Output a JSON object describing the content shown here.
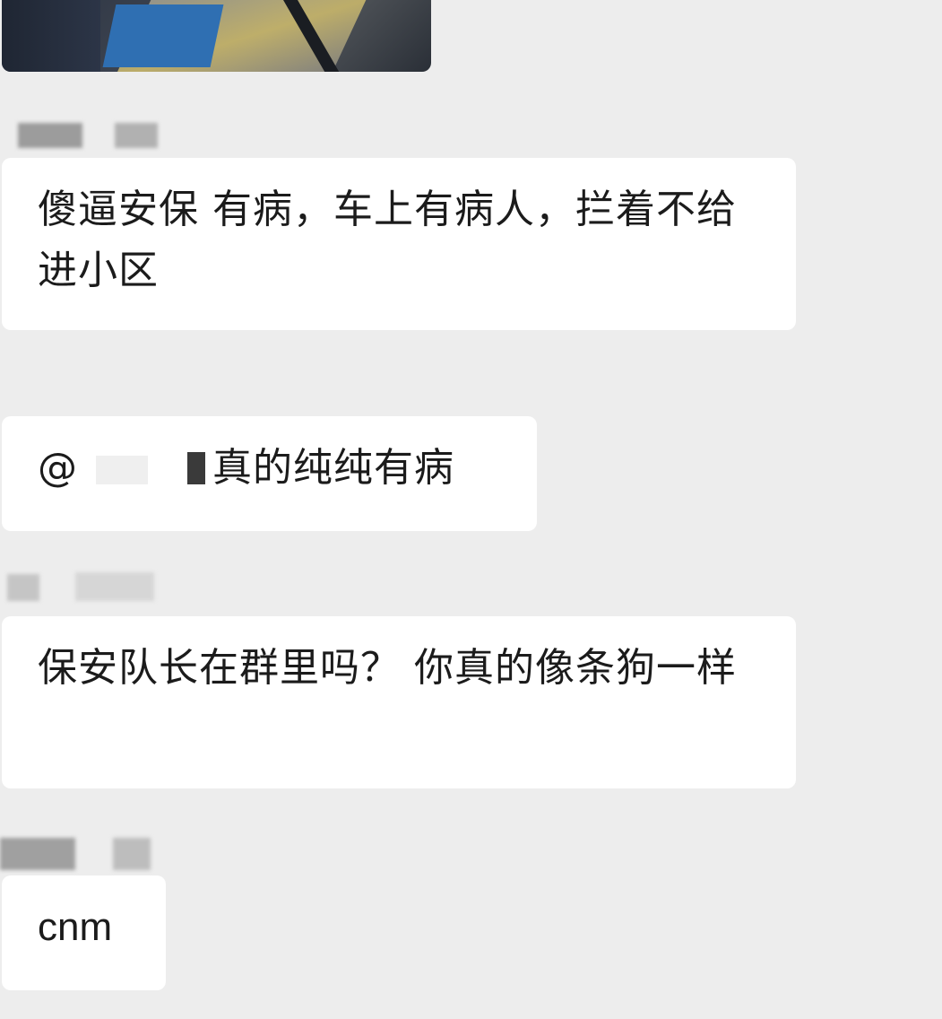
{
  "messages": [
    {
      "id": 1,
      "text": "傻逼安保 有病，车上有病人，拦着不给进小区"
    },
    {
      "id": 2,
      "mention_prefix": "@",
      "text": "真的纯纯有病"
    },
    {
      "id": 3,
      "text": "保安队长在群里吗？ 你真的像条狗一样"
    },
    {
      "id": 4,
      "text": "cnm"
    }
  ]
}
